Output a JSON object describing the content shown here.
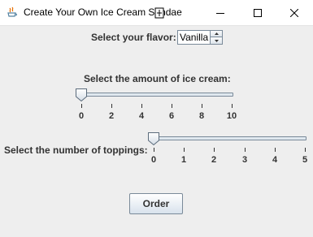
{
  "window": {
    "title": "Create Your Own Ice Cream Sundae"
  },
  "flavor": {
    "label": "Select your flavor:",
    "value": "Vanilla"
  },
  "amount": {
    "label": "Select the amount of ice cream:",
    "min": 0,
    "max": 10,
    "value": 0,
    "tick_labels": [
      "0",
      "2",
      "4",
      "6",
      "8",
      "10"
    ]
  },
  "toppings": {
    "label": "Select the number of toppings:",
    "min": 0,
    "max": 5,
    "value": 0,
    "tick_labels": [
      "0",
      "1",
      "2",
      "3",
      "4",
      "5"
    ]
  },
  "order_button": {
    "label": "Order"
  },
  "colors": {
    "background": "#eeeeee",
    "text": "#333333",
    "track_border": "#7a8a99"
  }
}
